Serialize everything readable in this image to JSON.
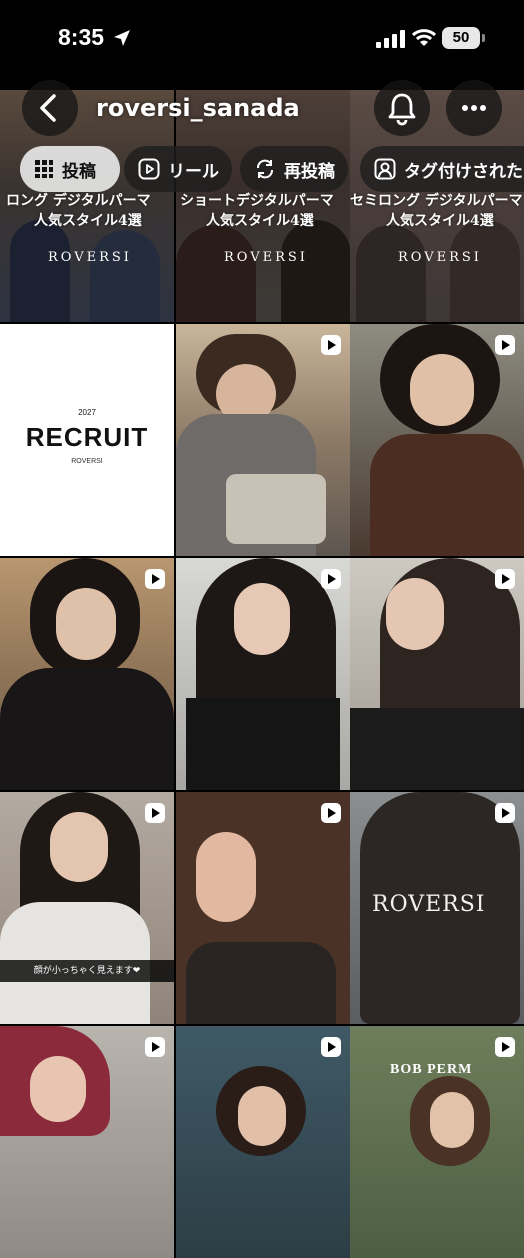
{
  "status_bar": {
    "time": "8:35",
    "battery": "50"
  },
  "profile": {
    "handle": "roversi_sanada"
  },
  "tabs": [
    {
      "label": "投稿"
    },
    {
      "label": "リール"
    },
    {
      "label": "再投稿"
    },
    {
      "label": "タグ付けされた"
    }
  ],
  "posts": {
    "row1": [
      {
        "title": "ロング デジタルパーマ",
        "subtitle": "人気スタイル4選",
        "watermark": "ROVERSI"
      },
      {
        "title": "ショートデジタルパーマ",
        "subtitle": "人気スタイル4選",
        "watermark": "ROVERSI"
      },
      {
        "title": "セミロング デジタルパーマ",
        "subtitle": "人気スタイル4選",
        "watermark": "ROVERSI"
      }
    ],
    "recruit": {
      "year": "2027",
      "title": "RECRUIT",
      "brand": "ROVERSI"
    },
    "caption_r4c1": "顔が小っちゃく見えます❤︎",
    "watermark_r4c3": "ROVERSI",
    "label_r5c3": "BOB PERM"
  },
  "colors": {
    "accent": "#ffffff",
    "background": "#000000"
  }
}
